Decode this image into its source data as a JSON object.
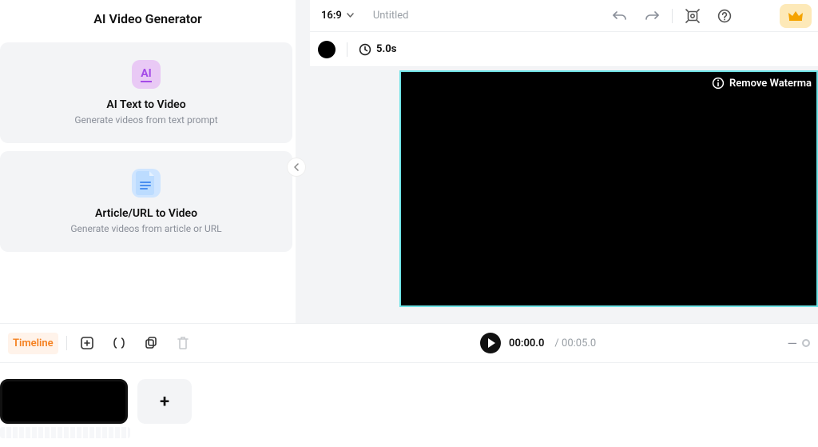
{
  "sidebar": {
    "title": "AI Video Generator",
    "cards": [
      {
        "icon_label": "AI",
        "title": "AI Text to Video",
        "sub": "Generate videos from text prompt"
      },
      {
        "title": "Article/URL to Video",
        "sub": "Generate videos from article or URL"
      }
    ]
  },
  "toolbar": {
    "aspect_ratio": "16:9",
    "title": "Untitled"
  },
  "clip": {
    "duration_label": "5.0s"
  },
  "watermark": {
    "label": "Remove Waterma"
  },
  "playbar": {
    "timeline_label": "Timeline",
    "current": "00:00.0",
    "sep": " / ",
    "total": "00:05.0",
    "minus": "—"
  },
  "add_clip": {
    "label": "+"
  }
}
